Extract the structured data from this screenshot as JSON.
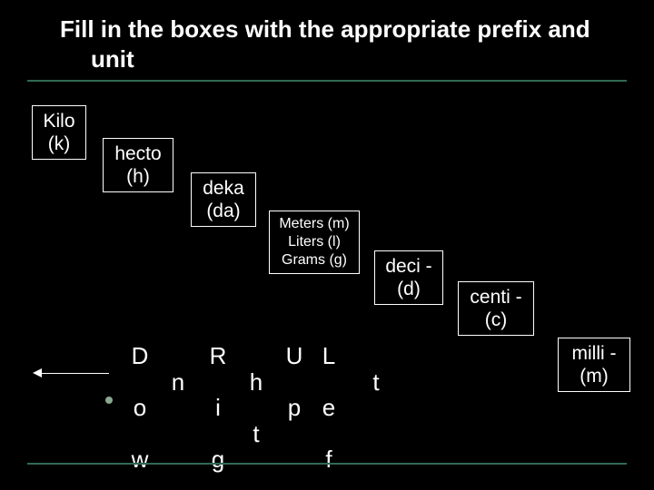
{
  "title": "Fill in the boxes with the appropriate prefix and unit",
  "boxes": {
    "kilo": {
      "line1": "Kilo",
      "line2": "(k)"
    },
    "hecto": {
      "line1": "hecto",
      "line2": "(h)"
    },
    "deka": {
      "line1": "deka",
      "line2": "(da)"
    },
    "base": {
      "line1": "Meters (m)",
      "line2": "Liters (l)",
      "line3": "Grams (g)"
    },
    "deci": {
      "line1": "deci -",
      "line2": "(d)"
    },
    "centi": {
      "line1": "centi -",
      "line2": "(c)"
    },
    "milli": {
      "line1": "milli -",
      "line2": "(m)"
    }
  },
  "mnemonic": {
    "c1": {
      "r1": "D",
      "r2": "",
      "r3": "o",
      "r4": "",
      "r5": "w"
    },
    "c2": {
      "r1": "",
      "r2": "n",
      "r3": "",
      "r4": "",
      "r5": ""
    },
    "c3": {
      "r1": "R",
      "r2": "",
      "r3": "i",
      "r4": "",
      "r5": "g"
    },
    "c4": {
      "r1": "",
      "r2": "h",
      "r3": "",
      "r4": "t",
      "r5": ""
    },
    "c5": {
      "r1": "U",
      "r2": "",
      "r3": "p",
      "r4": "",
      "r5": ""
    },
    "c6": {
      "r1": "L",
      "r2": "",
      "r3": "e",
      "r4": "",
      "r5": "f"
    },
    "c7": {
      "r1": "",
      "r2": "t",
      "r3": "",
      "r4": "",
      "r5": ""
    }
  }
}
